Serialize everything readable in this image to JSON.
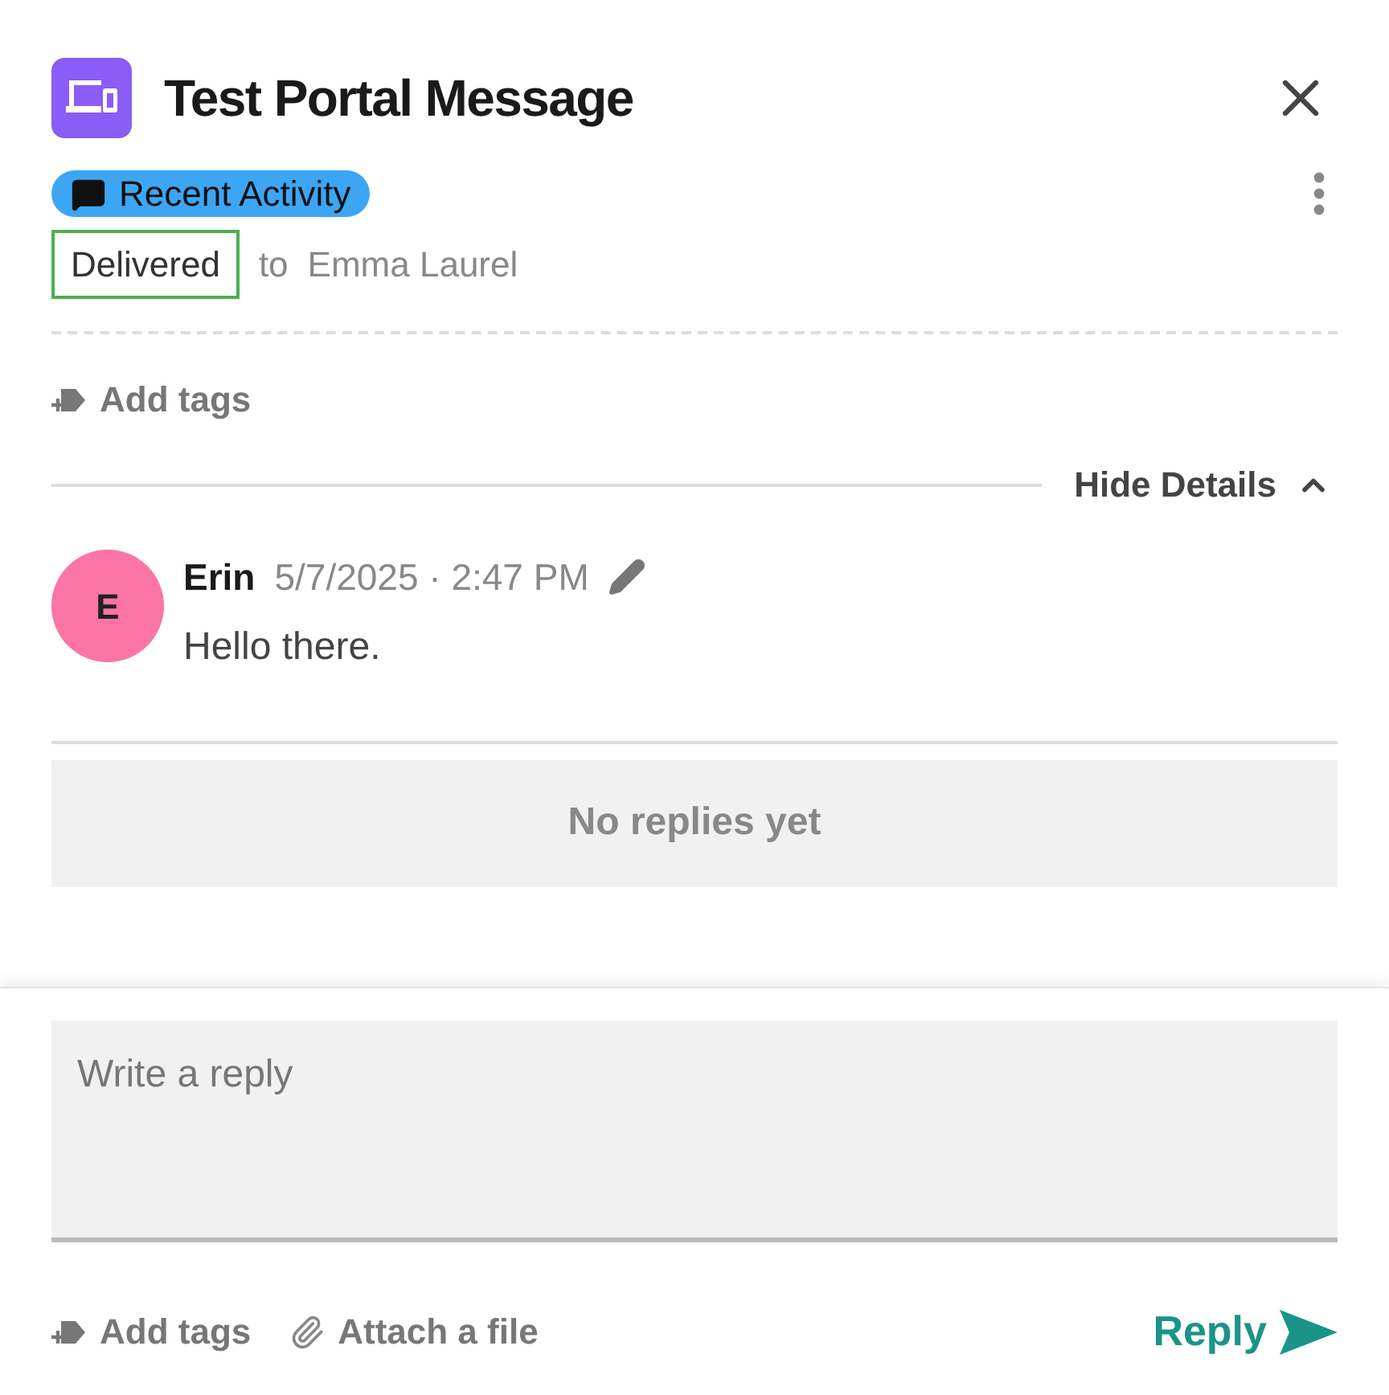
{
  "header": {
    "title": "Test Portal Message"
  },
  "activity_chip": {
    "label": "Recent Activity"
  },
  "status": {
    "label": "Delivered",
    "recipient_prefix": "to",
    "recipient": "Emma Laurel"
  },
  "add_tags": "Add tags",
  "details_toggle": {
    "label": "Hide Details",
    "expanded": true
  },
  "message": {
    "avatar": "E",
    "author": "Erin",
    "timestamp": "5/7/2025 · 2:47 PM",
    "body": "Hello there."
  },
  "replies_empty": "No replies yet",
  "composer": {
    "placeholder": "Write a reply",
    "add_tags": "Add tags",
    "attach": "Attach a file",
    "send": "Reply"
  }
}
